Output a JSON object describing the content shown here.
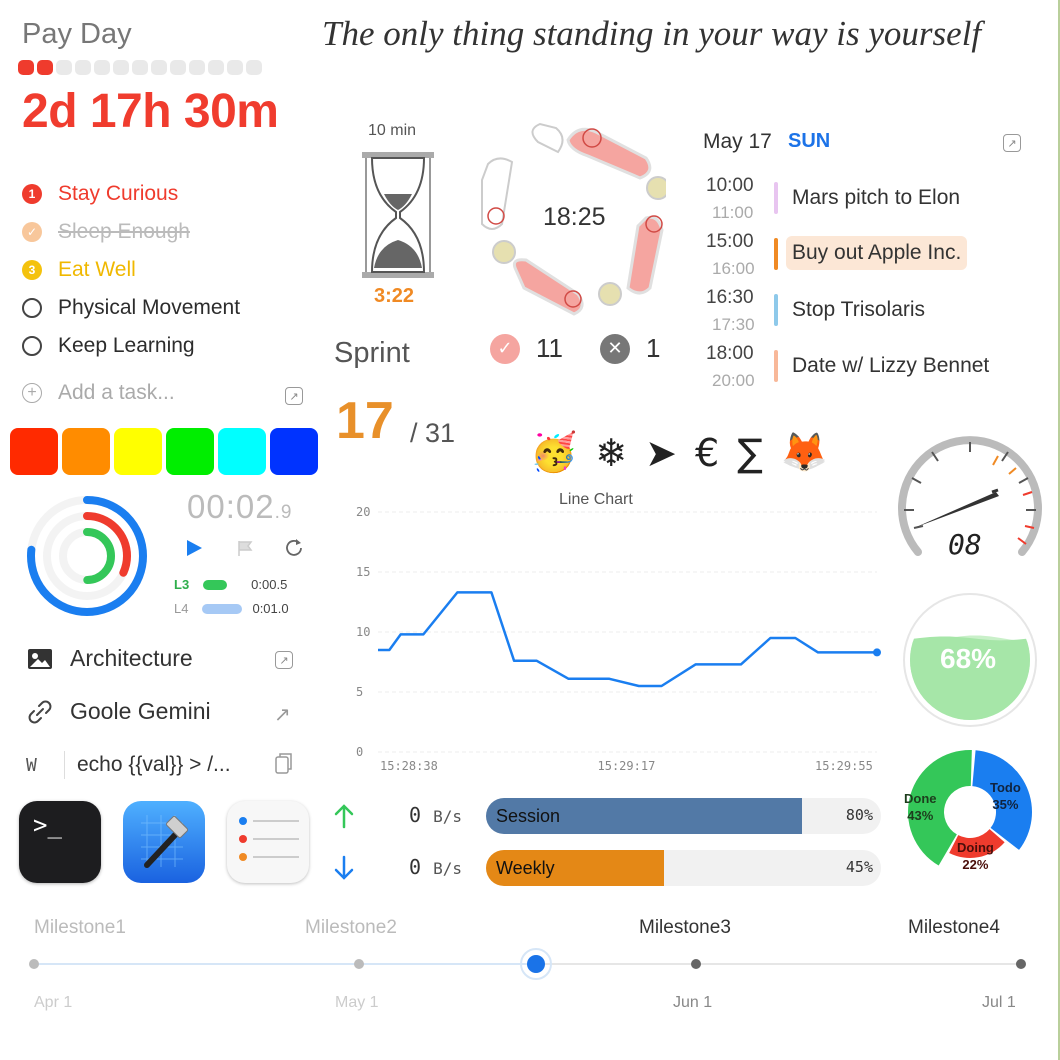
{
  "payday": {
    "title": "Pay Day",
    "countdown": "2d 17h 30m",
    "progress_filled": 2,
    "progress_total": 13
  },
  "quote": "The only thing standing in your way is yourself",
  "tasks": [
    {
      "number": "1",
      "label": "Stay Curious",
      "state": "priority"
    },
    {
      "number": "",
      "label": "Sleep Enough",
      "state": "done"
    },
    {
      "number": "3",
      "label": "Eat Well",
      "state": "priority"
    },
    {
      "number": "",
      "label": "Physical Movement",
      "state": "open"
    },
    {
      "number": "",
      "label": "Keep Learning",
      "state": "open"
    }
  ],
  "add_task": {
    "placeholder": "Add a task..."
  },
  "swatches": [
    "#ff2a00",
    "#ff8c00",
    "#ffff00",
    "#00ee00",
    "#00ffff",
    "#0033ff"
  ],
  "stopwatch": {
    "time": "00:02",
    "fraction": ".9",
    "laps": [
      {
        "name": "L3",
        "time": "0:00.5"
      },
      {
        "name": "L4",
        "time": "0:01.0"
      }
    ]
  },
  "links": [
    {
      "icon": "image-icon",
      "label": "Architecture"
    },
    {
      "icon": "link-icon",
      "label": "Goole Gemini"
    },
    {
      "icon": "w-letter-icon",
      "prefix": "W",
      "label": "echo {{val}} > /..."
    }
  ],
  "apps": [
    "terminal-app",
    "xcode-app",
    "reminders-app"
  ],
  "timer": {
    "label": "10 min",
    "remaining": "3:22"
  },
  "pomodoro": {
    "time": "18:25",
    "completed": "11",
    "failed": "1"
  },
  "sprint": {
    "label": "Sprint",
    "current": "17",
    "total": "/ 31"
  },
  "calendar": {
    "date": "May 17",
    "day": "SUN",
    "events": [
      {
        "start": "10:00",
        "end": "11:00",
        "title": "Mars pitch to Elon",
        "color": "#e8c5f0"
      },
      {
        "start": "15:00",
        "end": "16:00",
        "title": "Buy out Apple Inc.",
        "color": "#f08a24"
      },
      {
        "start": "16:30",
        "end": "17:30",
        "title": "Stop Trisolaris",
        "color": "#8ec9ea"
      },
      {
        "start": "18:00",
        "end": "20:00",
        "title": "Date w/ Lizzy Bennet",
        "color": "#f8b899"
      }
    ]
  },
  "emojis": [
    "🥳",
    "❄",
    "➤",
    "€",
    "∑",
    "🦊"
  ],
  "chart_data": {
    "type": "line",
    "title": "Line Chart",
    "x_ticks": [
      "15:28:38",
      "15:29:17",
      "15:29:55"
    ],
    "y_ticks": [
      "20",
      "15",
      "10",
      "5",
      "0"
    ],
    "ylim": [
      0,
      20
    ],
    "x": [
      0,
      0.5,
      1,
      2,
      3.5,
      5,
      6,
      7,
      8.4,
      10.2,
      11.5,
      12.5,
      14,
      16,
      17.3,
      18.4,
      19.4,
      21.3,
      22
    ],
    "values": [
      8.5,
      8.5,
      9.8,
      9.8,
      13.3,
      13.3,
      7.6,
      7.6,
      6.1,
      6.1,
      5.5,
      5.5,
      7.3,
      7.3,
      9.5,
      9.5,
      8.3,
      8.3,
      8.3
    ]
  },
  "speedometer": {
    "value": "08"
  },
  "water": {
    "percent": "68%",
    "level": 0.68
  },
  "donut": {
    "segments": [
      {
        "label": "Done",
        "pct": "43%",
        "color": "#34c759"
      },
      {
        "label": "Todo",
        "pct": "35%",
        "color": "#1a7ef0"
      },
      {
        "label": "Doing",
        "pct": "22%",
        "color": "#ef3b2d"
      }
    ]
  },
  "network": {
    "up": "0",
    "down": "0",
    "unit": "B/s"
  },
  "usage": [
    {
      "label": "Session",
      "pct": "80%",
      "fraction": 0.8,
      "color": "#5279a6"
    },
    {
      "label": "Weekly",
      "pct": "45%",
      "fraction": 0.45,
      "color": "#e48816"
    }
  ],
  "milestones": [
    {
      "label": "Milestone1",
      "date": "Apr 1",
      "active": false
    },
    {
      "label": "Milestone2",
      "date": "May 1",
      "active": false
    },
    {
      "label": "Milestone3",
      "date": "Jun 1",
      "active": true
    },
    {
      "label": "Milestone4",
      "date": "Jul 1",
      "active": true
    }
  ]
}
